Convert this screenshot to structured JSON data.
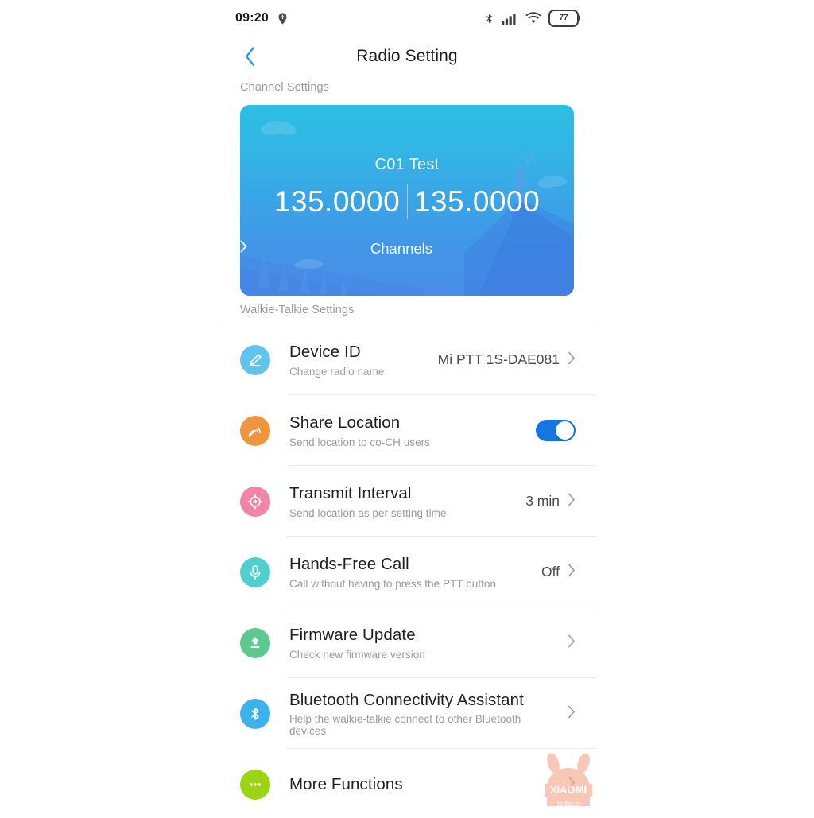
{
  "statusbar": {
    "time": "09:20",
    "location_icon": "location-pin-icon",
    "bluetooth_icon": "bluetooth-icon",
    "signal_icon": "cellular-signal-icon",
    "wifi_icon": "wifi-icon",
    "battery_level": "77"
  },
  "navbar": {
    "back_icon": "chevron-left-icon",
    "title": "Radio Setting"
  },
  "sections": {
    "channel_settings_label": "Channel Settings",
    "walkie_talkie_label": "Walkie-Talkie Settings"
  },
  "channel_card": {
    "name": "C01 Test",
    "freq_rx": "135.0000",
    "freq_tx": "135.0000",
    "channels_link": "Channels",
    "chevron": "›",
    "gradient_top": "#2CBFE2",
    "gradient_bottom": "#4A8CE8"
  },
  "rows": [
    {
      "title": "Device ID",
      "subtitle": "Change radio name",
      "value": "Mi PTT 1S-DAE081",
      "icon": "pen-edit-icon",
      "icon_color": "#5FC3EC",
      "control": "chevron"
    },
    {
      "title": "Share Location",
      "subtitle": "Send location to co-CH users",
      "value": "",
      "icon": "broadcast-location-icon",
      "icon_color": "#F0943E",
      "control": "toggle",
      "toggle_on": true
    },
    {
      "title": "Transmit Interval",
      "subtitle": "Send location as per setting time",
      "value": "3 min",
      "icon": "crosshair-target-icon",
      "icon_color": "#F285A5",
      "control": "chevron"
    },
    {
      "title": "Hands-Free Call",
      "subtitle": "Call without having to press the PTT button",
      "value": "Off",
      "icon": "microphone-icon",
      "icon_color": "#4FD0CE",
      "control": "chevron"
    },
    {
      "title": "Firmware Update",
      "subtitle": "Check new firmware version",
      "value": "",
      "icon": "upload-arrow-icon",
      "icon_color": "#5CC98E",
      "control": "chevron"
    },
    {
      "title": "Bluetooth Connectivity Assistant",
      "subtitle": "Help the walkie-talkie connect to other Bluetooth devices",
      "value": "",
      "icon": "bluetooth-icon",
      "icon_color": "#3CB2EC",
      "control": "chevron"
    },
    {
      "title": "More Functions",
      "subtitle": "",
      "value": "",
      "icon": "ellipsis-icon",
      "icon_color": "#9BD315",
      "control": "chevron"
    }
  ],
  "watermark": {
    "brand": "XIAOMI",
    "site": "today.it",
    "color": "#F5A58A"
  }
}
